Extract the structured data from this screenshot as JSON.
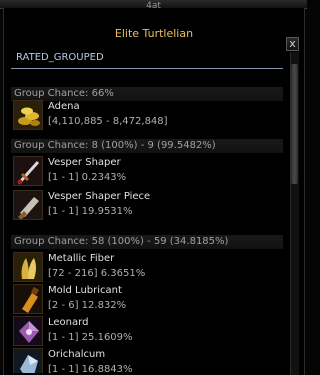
{
  "window": {
    "top_label": "4at",
    "title": "Elite Turtlelian",
    "close_label": "x"
  },
  "tab": {
    "label": "RATED_GROUPED"
  },
  "groups": [
    {
      "header": "Group Chance: 66%",
      "items": [
        {
          "name": "Adena",
          "stats": "[4,110,885 - 8,472,848]",
          "icon": "gold-coins-icon"
        }
      ]
    },
    {
      "header": "Group Chance: 8 (100%) - 9 (99.5482%)",
      "items": [
        {
          "name": "Vesper Shaper",
          "stats": "[1 - 1] 0.2343%",
          "icon": "sword-icon"
        },
        {
          "name": "Vesper Shaper Piece",
          "stats": "[1 - 1] 19.9531%",
          "icon": "sword-piece-icon"
        }
      ]
    },
    {
      "header": "Group Chance: 58 (100%) - 59 (34.8185%)",
      "items": [
        {
          "name": "Metallic Fiber",
          "stats": "[72 - 216] 6.3651%",
          "icon": "fiber-icon"
        },
        {
          "name": "Mold Lubricant",
          "stats": "[2 - 6] 12.832%",
          "icon": "lubricant-bottle-icon"
        },
        {
          "name": "Leonard",
          "stats": "[1 - 1] 25.1609%",
          "icon": "leonard-gem-icon"
        },
        {
          "name": "Orichalcum",
          "stats": "[1 - 1] 16.8843%",
          "icon": "orichalcum-ore-icon"
        }
      ]
    }
  ],
  "colors": {
    "title": "#e8c060",
    "tab_label": "#b8c8e8",
    "background": "#000000"
  }
}
